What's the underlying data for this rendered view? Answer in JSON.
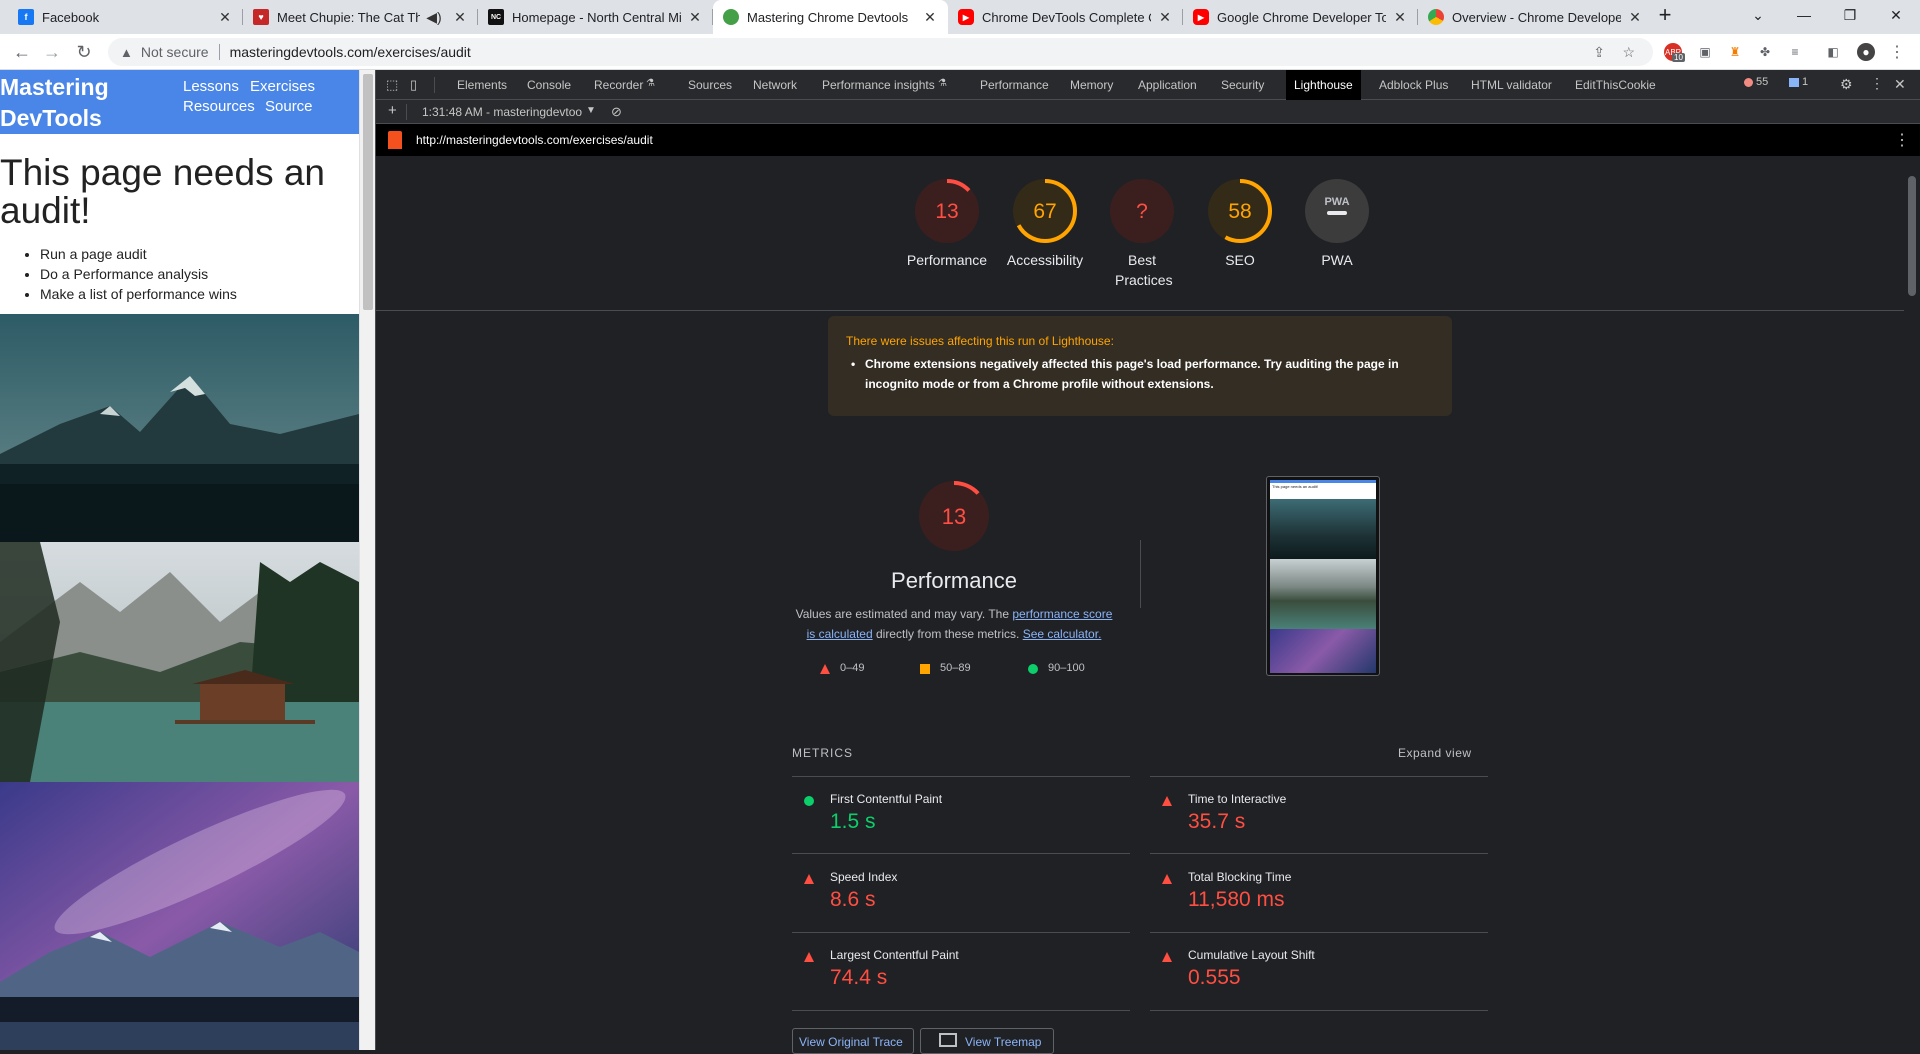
{
  "browser": {
    "tabs": [
      {
        "title": "Facebook",
        "icon": "facebook-icon",
        "color": "#1877f2",
        "glyph": "f"
      },
      {
        "title": "Meet Chupie: The Cat That L",
        "icon": "cat-icon",
        "color": "#c62828",
        "glyph": "♥"
      },
      {
        "title": "Homepage - North Central Mich",
        "icon": "ncmc-icon",
        "color": "#111111",
        "glyph": "NC"
      },
      {
        "title": "Mastering Chrome Devtools",
        "icon": "devtools-icon",
        "color": "#43a047",
        "glyph": "⬢"
      },
      {
        "title": "Chrome DevTools Complete Co",
        "icon": "youtube-icon",
        "color": "#ff0000",
        "glyph": "▶"
      },
      {
        "title": "Google Chrome Developer Tool",
        "icon": "youtube-icon",
        "color": "#ff0000",
        "glyph": "▶"
      },
      {
        "title": "Overview - Chrome Developers",
        "icon": "chrome-icon",
        "color": "#4285f4",
        "glyph": "●"
      }
    ],
    "address": {
      "security": "Not secure",
      "url": "masteringdevtools.com/exercises/audit"
    },
    "extension_badge": "10"
  },
  "page": {
    "logo": "Mastering DevTools",
    "nav": [
      "Lessons",
      "Exercises",
      "Resources",
      "Source"
    ],
    "title": "This page needs an audit!",
    "tasks": [
      "Run a page audit",
      "Do a Performance analysis",
      "Make a list of performance wins"
    ]
  },
  "devtools": {
    "tabs": [
      "Elements",
      "Console",
      "Recorder",
      "Sources",
      "Network",
      "Performance insights",
      "Performance",
      "Memory",
      "Application",
      "Security",
      "Lighthouse",
      "Adblock Plus",
      "HTML validator",
      "EditThisCookie"
    ],
    "active_tab": "Lighthouse",
    "error_count": "55",
    "message_count": "1",
    "report_selector": "1:31:48 AM - masteringdevtoo",
    "report_url": "http://masteringdevtools.com/exercises/audit"
  },
  "report": {
    "gauges": [
      {
        "label": "Performance",
        "score": "13",
        "fraction": 0.13,
        "color": "#ff4e42",
        "bg": "#3b1f1f"
      },
      {
        "label": "Accessibility",
        "score": "67",
        "fraction": 0.67,
        "color": "#ffa400",
        "bg": "#342a18"
      },
      {
        "label": "Best Practices",
        "score": "?",
        "fraction": 0,
        "color": "#ff4e42",
        "bg": "#3b1f1f"
      },
      {
        "label": "SEO",
        "score": "58",
        "fraction": 0.58,
        "color": "#ffa400",
        "bg": "#342a18"
      },
      {
        "label": "PWA",
        "score": "PWA",
        "fraction": 0,
        "color": "#e8eaed",
        "bg": "#3c3c3c"
      }
    ],
    "warning": {
      "title": "There were issues affecting this run of Lighthouse:",
      "item": "Chrome extensions negatively affected this page's load performance. Try auditing the page in incognito mode or from a Chrome profile without extensions."
    },
    "perf": {
      "score": "13",
      "fraction": 0.13,
      "title": "Performance",
      "desc_pre": "Values are estimated and may vary. The ",
      "desc_link1": "performance score is calculated",
      "desc_mid": " directly from these metrics. ",
      "desc_link2": "See calculator."
    },
    "legend": [
      {
        "range": "0–49",
        "color": "#ff4e42",
        "shape": "triangle"
      },
      {
        "range": "50–89",
        "color": "#ffa400",
        "shape": "square"
      },
      {
        "range": "90–100",
        "color": "#0cce6b",
        "shape": "circle"
      }
    ],
    "metrics_heading": "METRICS",
    "expand_label": "Expand view",
    "metrics": [
      {
        "name": "First Contentful Paint",
        "value": "1.5 s",
        "status": "pass"
      },
      {
        "name": "Time to Interactive",
        "value": "35.7 s",
        "status": "fail"
      },
      {
        "name": "Speed Index",
        "value": "8.6 s",
        "status": "fail"
      },
      {
        "name": "Total Blocking Time",
        "value": "11,580 ms",
        "status": "fail"
      },
      {
        "name": "Largest Contentful Paint",
        "value": "74.4 s",
        "status": "fail"
      },
      {
        "name": "Cumulative Layout Shift",
        "value": "0.555",
        "status": "fail"
      }
    ],
    "buttons": {
      "trace": "View Original Trace",
      "treemap": "View Treemap"
    },
    "thumb_caption": "This page needs an audit!"
  },
  "colors": {
    "pass": "#0cce6b",
    "average": "#ffa400",
    "fail": "#ff4e42",
    "link": "#8ab4f8",
    "accent": "#4a86e8"
  }
}
